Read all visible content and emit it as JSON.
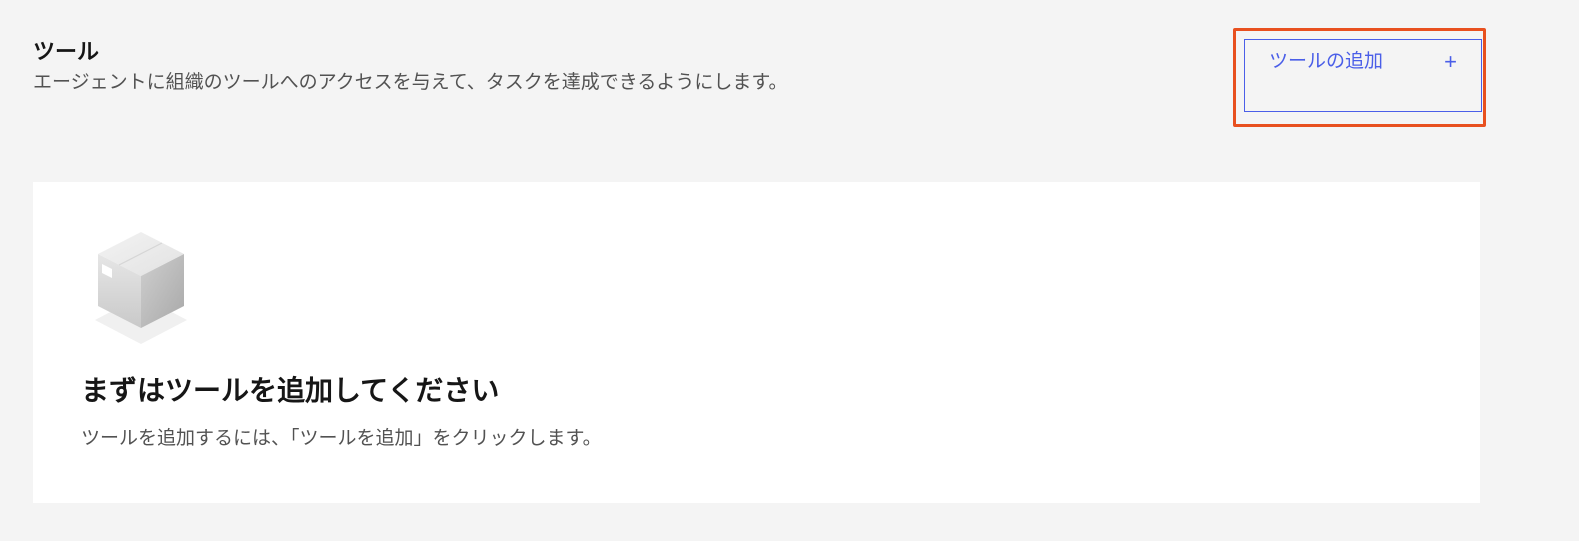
{
  "section": {
    "title": "ツール",
    "description": "エージェントに組織のツールへのアクセスを与えて、タスクを達成できるようにします。"
  },
  "actions": {
    "add_tool_label": "ツールの追加",
    "add_icon": "+",
    "add_icon_name": "plus-icon"
  },
  "empty_state": {
    "illustration": "box-icon",
    "title": "まずはツールを追加してください",
    "description": "ツールを追加するには、「ツールを追加」をクリックします。"
  },
  "colors": {
    "accent": "#4a5ee8",
    "highlight": "#e8501f",
    "background": "#f4f4f4",
    "card": "#ffffff"
  }
}
